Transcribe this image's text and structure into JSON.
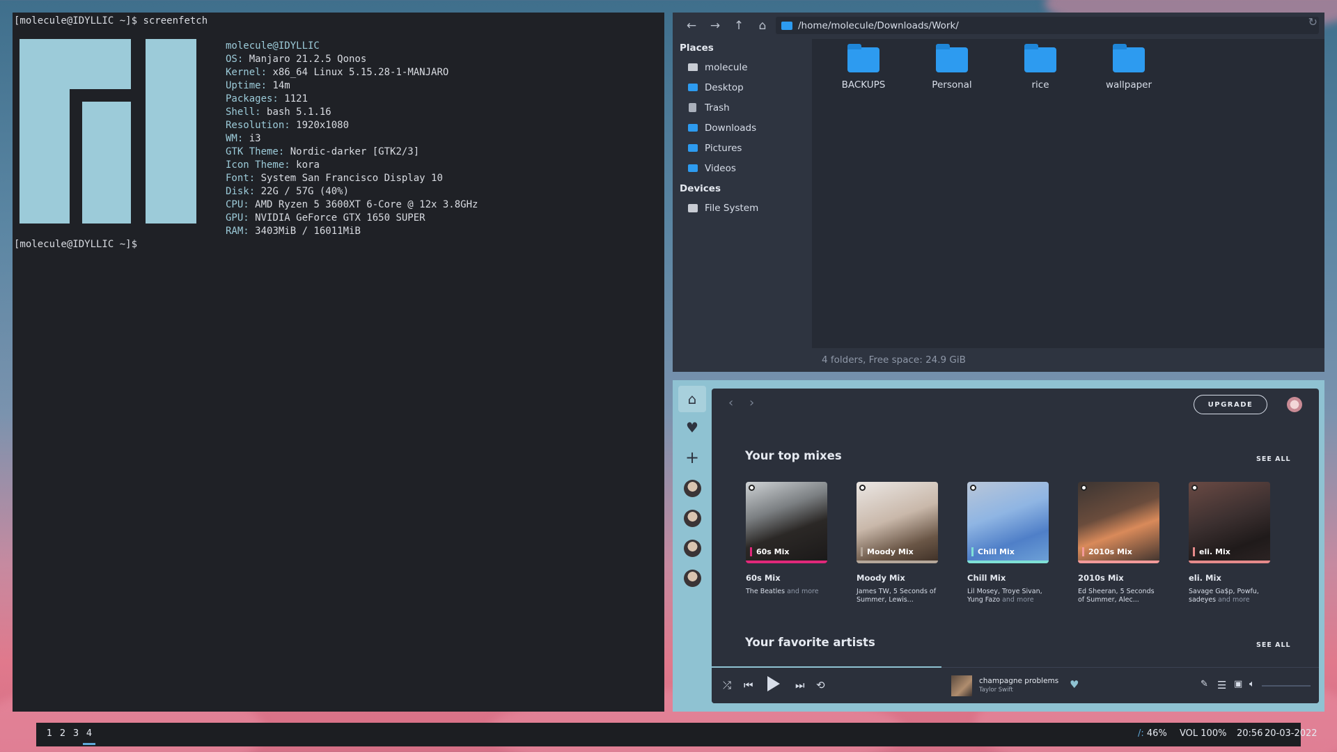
{
  "terminal": {
    "prompt": "[molecule@IDYLLIC ~]$",
    "command": "screenfetch",
    "user_host": "molecule@IDYLLIC",
    "info": [
      {
        "key": "OS:",
        "value": "Manjaro 21.2.5 Qonos"
      },
      {
        "key": "Kernel:",
        "value": "x86_64 Linux 5.15.28-1-MANJARO"
      },
      {
        "key": "Uptime:",
        "value": "14m"
      },
      {
        "key": "Packages:",
        "value": "1121"
      },
      {
        "key": "Shell:",
        "value": "bash 5.1.16"
      },
      {
        "key": "Resolution:",
        "value": "1920x1080"
      },
      {
        "key": "WM:",
        "value": "i3"
      },
      {
        "key": "GTK Theme:",
        "value": "Nordic-darker [GTK2/3]"
      },
      {
        "key": "Icon Theme:",
        "value": "kora"
      },
      {
        "key": "Font:",
        "value": "System San Francisco Display 10"
      },
      {
        "key": "Disk:",
        "value": "22G / 57G (40%)"
      },
      {
        "key": "CPU:",
        "value": "AMD Ryzen 5 3600XT 6-Core @ 12x 3.8GHz"
      },
      {
        "key": "GPU:",
        "value": "NVIDIA GeForce GTX 1650 SUPER"
      },
      {
        "key": "RAM:",
        "value": "3403MiB / 16011MiB"
      }
    ]
  },
  "file_manager": {
    "path": "/home/molecule/Downloads/Work/",
    "places_header": "Places",
    "places": [
      {
        "label": "molecule",
        "icon": "home-icon"
      },
      {
        "label": "Desktop",
        "icon": "folder-icon"
      },
      {
        "label": "Trash",
        "icon": "trash-icon"
      },
      {
        "label": "Downloads",
        "icon": "folder-icon"
      },
      {
        "label": "Pictures",
        "icon": "folder-icon"
      },
      {
        "label": "Videos",
        "icon": "folder-icon"
      }
    ],
    "devices_header": "Devices",
    "devices": [
      {
        "label": "File System",
        "icon": "drive-icon"
      }
    ],
    "folders": [
      "BACKUPS",
      "Personal",
      "rice",
      "wallpaper"
    ],
    "status": "4 folders, Free space: 24.9 GiB"
  },
  "spotify": {
    "upgrade_label": "UPGRADE",
    "top_mixes_title": "Your top mixes",
    "favorite_artists_title": "Your favorite artists",
    "see_all": "SEE ALL",
    "mixes": [
      {
        "label": "60s Mix",
        "name": "60s Mix",
        "desc": "The Beatles",
        "more": "and more",
        "accent": "#e0287a"
      },
      {
        "label": "Moody Mix",
        "name": "Moody Mix",
        "desc": "James TW, 5 Seconds of Summer, Lewis...",
        "more": "",
        "accent": "#b5a79a"
      },
      {
        "label": "Chill Mix",
        "name": "Chill Mix",
        "desc": "Lil Mosey, Troye Sivan, Yung Fazo",
        "more": "and more",
        "accent": "#7fe0d6"
      },
      {
        "label": "2010s Mix",
        "name": "2010s Mix",
        "desc": "Ed Sheeran, 5 Seconds of Summer, Alec...",
        "more": "",
        "accent": "#f29a9a"
      },
      {
        "label": "eli. Mix",
        "name": "eli. Mix",
        "desc": "Savage Ga$p, Powfu, sadeyes",
        "more": "and more",
        "accent": "#e58a8a"
      }
    ],
    "now_playing": {
      "title": "champagne problems",
      "artist": "Taylor Swift"
    }
  },
  "bar": {
    "workspaces": [
      "1",
      "2",
      "3",
      "4"
    ],
    "active_workspace": "4",
    "disk_prefix": "/:",
    "disk": " 46%",
    "volume": "VOL 100%",
    "time": "20:56",
    "date": "20-03-2022"
  },
  "colors": {
    "accent": "#5fa8d8",
    "logo": "#9ccbd9",
    "folder": "#2d9bf0"
  }
}
